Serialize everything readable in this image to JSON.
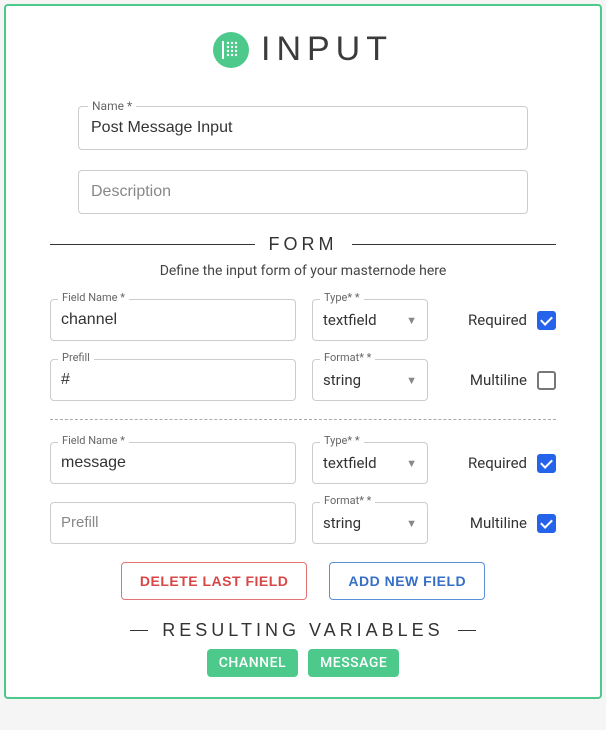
{
  "header": {
    "title": "INPUT"
  },
  "nameField": {
    "label": "Name *",
    "value": "Post Message Input"
  },
  "descField": {
    "placeholder": "Description"
  },
  "formSection": {
    "title": "FORM",
    "subtitle": "Define the input form of your masternode here"
  },
  "labels": {
    "fieldName": "Field Name *",
    "type": "Type* *",
    "prefill": "Prefill",
    "format": "Format* *",
    "required": "Required",
    "multiline": "Multiline"
  },
  "fields": [
    {
      "name": "channel",
      "type": "textfield",
      "required": true,
      "prefill": "#",
      "format": "string",
      "multiline": false
    },
    {
      "name": "message",
      "type": "textfield",
      "required": true,
      "prefill": "",
      "format": "string",
      "multiline": true
    }
  ],
  "buttons": {
    "delete": "DELETE LAST FIELD",
    "add": "ADD NEW FIELD"
  },
  "varsSection": {
    "title": "RESULTING VARIABLES",
    "chips": [
      "CHANNEL",
      "MESSAGE"
    ]
  }
}
